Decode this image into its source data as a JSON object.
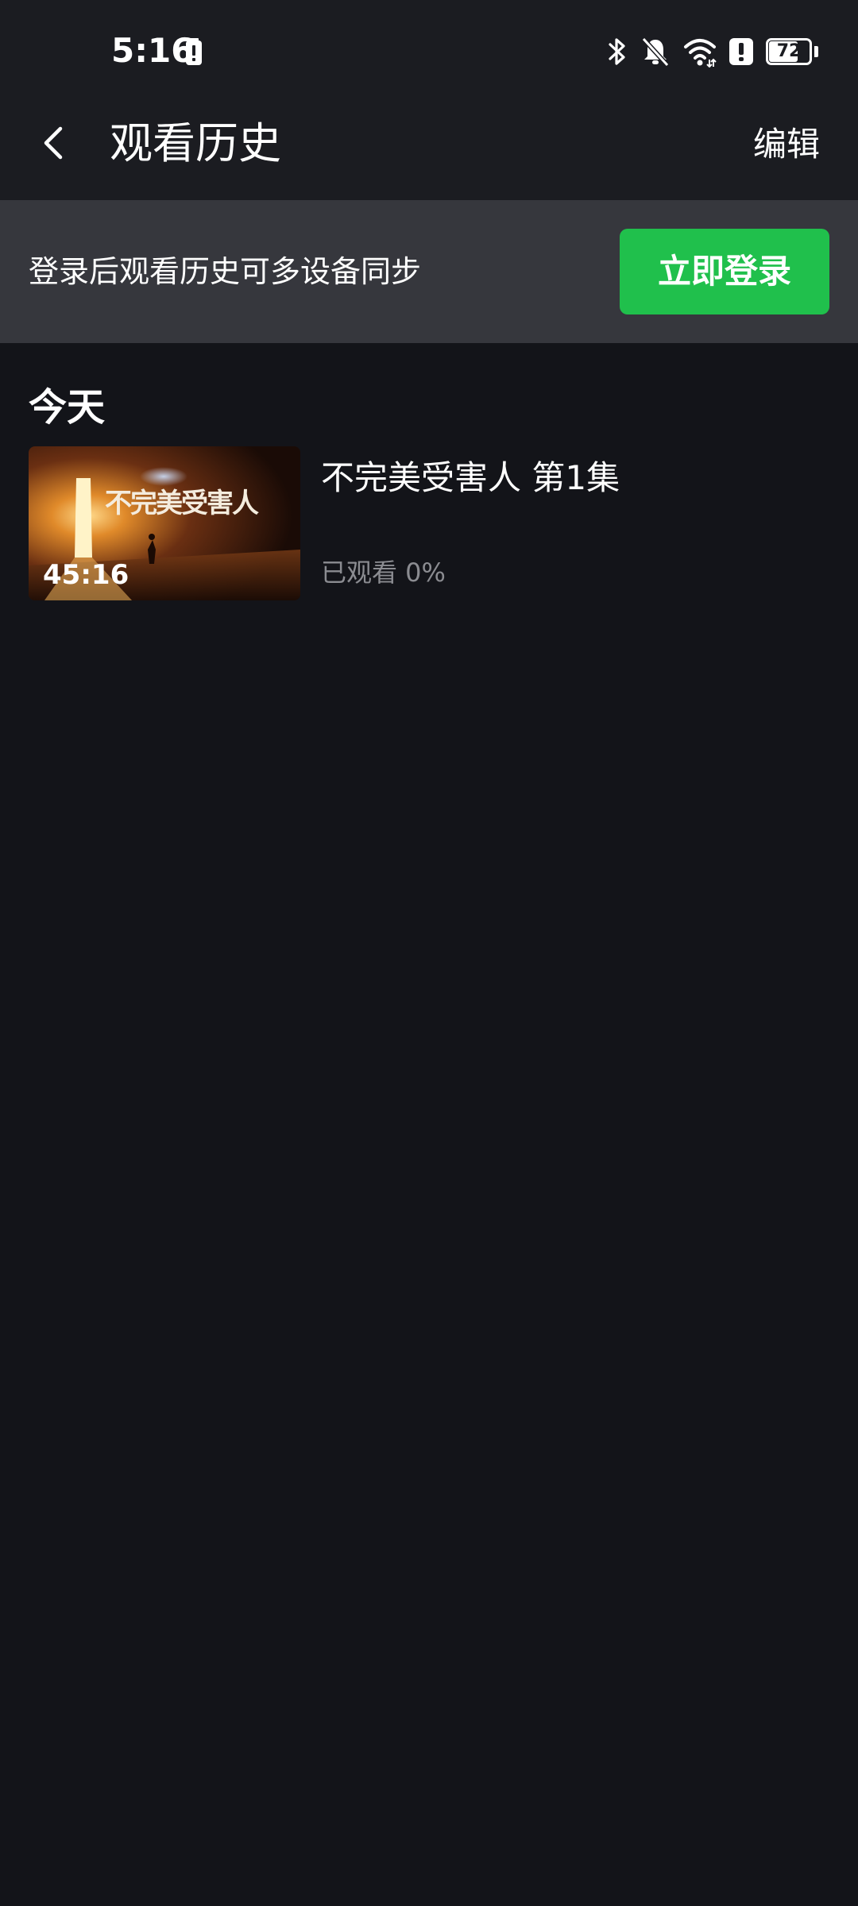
{
  "status_bar": {
    "time": "5:16",
    "battery_level": "72",
    "battery_fraction": 0.72,
    "icons": [
      "battery-alert-icon",
      "bluetooth-icon",
      "bell-muted-icon",
      "wifi-icon",
      "alert-icon",
      "battery-icon"
    ]
  },
  "header": {
    "title": "观看历史",
    "edit_label": "编辑",
    "back_icon": "chevron-left-icon"
  },
  "login_banner": {
    "prompt": "登录后观看历史可多设备同步",
    "button_label": "立即登录",
    "button_color": "#20c04c"
  },
  "history": {
    "section_label": "今天",
    "items": [
      {
        "thumbnail_title": "不完美受害人",
        "duration": "45:16",
        "title": "不完美受害人 第1集",
        "progress": "已观看 0%"
      }
    ]
  },
  "colors": {
    "background": "#131419",
    "header_background": "#1b1c21",
    "banner_background": "#36373d",
    "secondary_text": "#8b8c91"
  }
}
